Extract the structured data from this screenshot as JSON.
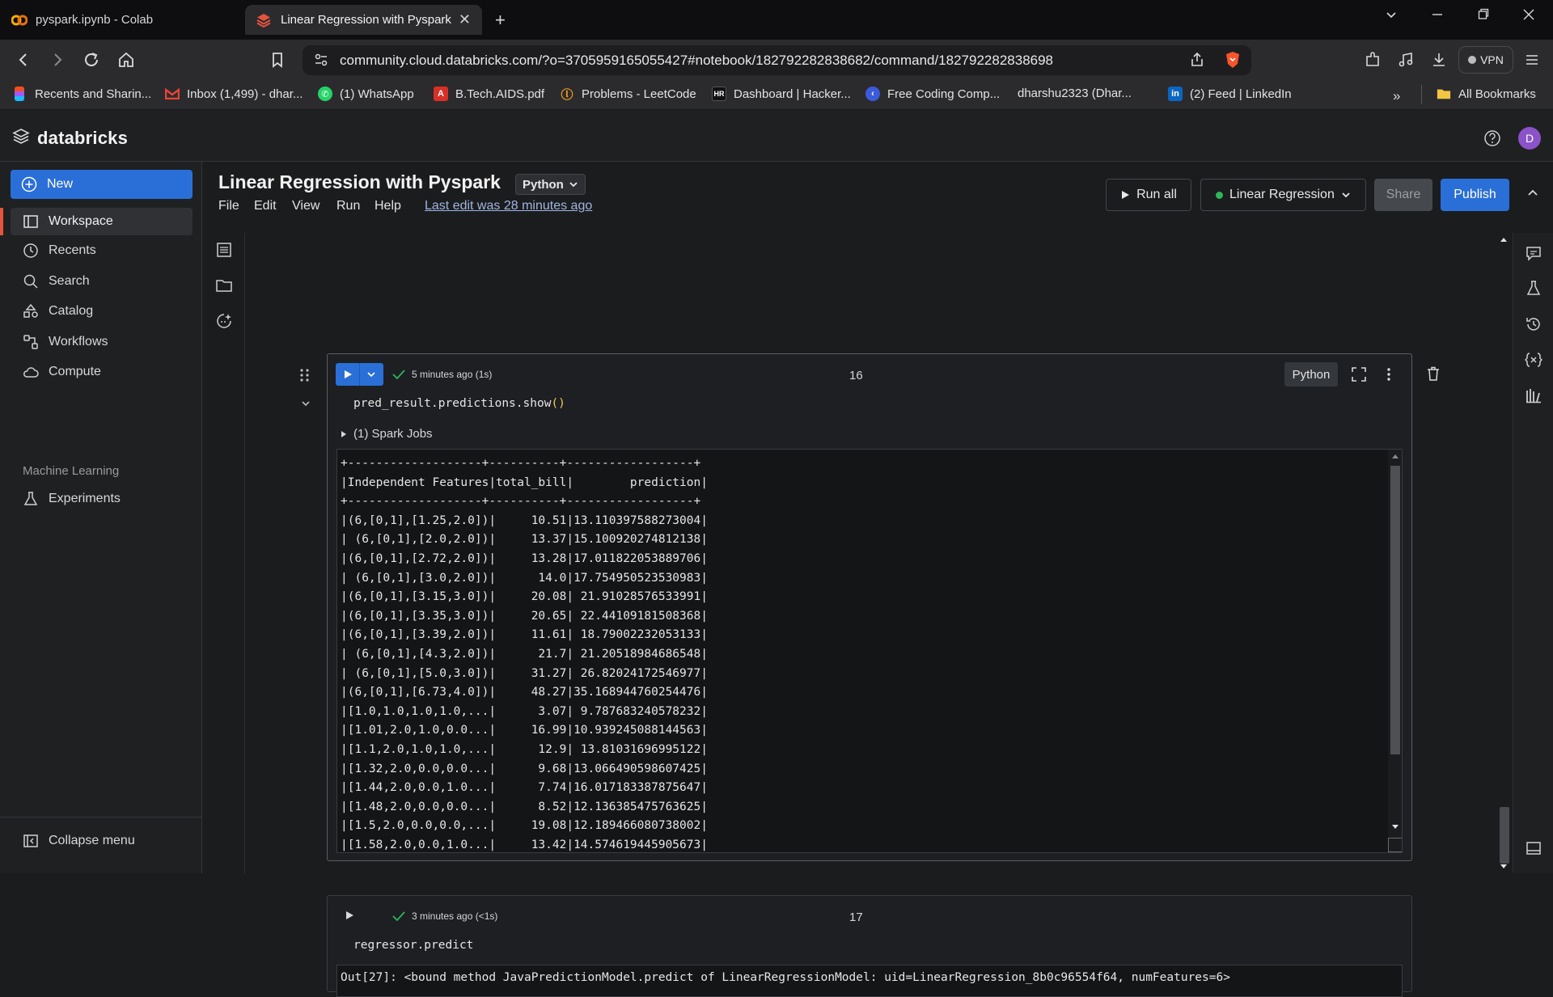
{
  "browser": {
    "tabs": [
      {
        "label": "pyspark.ipynb - Colab",
        "active": false
      },
      {
        "label": "Linear Regression with Pyspark",
        "active": true
      }
    ],
    "url": "community.cloud.databricks.com/?o=3705959165055427#notebook/182792282838682/command/182792282838698",
    "vpn_label": "VPN",
    "bookmarks": [
      "Recents and Sharin...",
      "Inbox (1,499) - dhar...",
      "(1) WhatsApp",
      "B.Tech.AIDS.pdf",
      "Problems - LeetCode",
      "Dashboard | Hacker...",
      "Free Coding Comp...",
      "dharshu2323 (Dhar...",
      "(2) Feed | LinkedIn"
    ],
    "all_bookmarks": "All Bookmarks"
  },
  "app": {
    "brand": "databricks",
    "avatar_initial": "D",
    "accent": "#2a6fd8"
  },
  "sidebar": {
    "new_label": "New",
    "items": [
      "Workspace",
      "Recents",
      "Search",
      "Catalog",
      "Workflows",
      "Compute"
    ],
    "ml_header": "Machine Learning",
    "ml_items": [
      "Experiments"
    ],
    "collapse_label": "Collapse menu"
  },
  "notebook": {
    "title": "Linear Regression with Pyspark",
    "language": "Python",
    "menus": [
      "File",
      "Edit",
      "View",
      "Run",
      "Help"
    ],
    "last_edit": "Last edit was 28 minutes ago",
    "run_all": "Run all",
    "cluster": "Linear Regression",
    "share": "Share",
    "publish": "Publish"
  },
  "cell16": {
    "status": "5 minutes ago (1s)",
    "number": "16",
    "lang": "Python",
    "code_prefix": "pred_result.predictions.show",
    "code_parens": "()",
    "jobs": "(1) Spark Jobs",
    "output": "+-------------------+----------+------------------+\n|Independent Features|total_bill|        prediction|\n+-------------------+----------+------------------+\n|(6,[0,1],[1.25,2.0])|     10.51|13.110397588273004|\n| (6,[0,1],[2.0,2.0])|     13.37|15.100920274812138|\n|(6,[0,1],[2.72,2.0])|     13.28|17.011822053889706|\n| (6,[0,1],[3.0,2.0])|      14.0|17.754950523530983|\n|(6,[0,1],[3.15,3.0])|     20.08| 21.91028576533991|\n|(6,[0,1],[3.35,3.0])|     20.65| 22.44109181508368|\n|(6,[0,1],[3.39,2.0])|     11.61| 18.79002232053133|\n| (6,[0,1],[4.3,2.0])|      21.7| 21.20518984686548|\n| (6,[0,1],[5.0,3.0])|     31.27| 26.82024172546977|\n|(6,[0,1],[6.73,4.0])|     48.27|35.168944760254476|\n|[1.0,1.0,1.0,1.0,...|      3.07| 9.787683240578232|\n|[1.01,2.0,1.0,0.0...|     16.99|10.939245088144563|\n|[1.1,2.0,1.0,1.0,...|      12.9| 13.81031696995122|\n|[1.32,2.0,0.0,0.0...|      9.68|13.066490598607425|\n|[1.44,2.0,0.0,1.0...|      7.74|16.017183387875647|\n|[1.48,2.0,0.0,0.0...|      8.52|12.136385475763625|\n|[1.5,2.0,0.0,0.0,...|     19.08|12.189466080738002|\n|[1.58,2.0,0.0,1.0...|     13.42|14.574619445905673|"
  },
  "cell17": {
    "status": "3 minutes ago (<1s)",
    "number": "17",
    "code": "regressor.predict",
    "output": "Out[27]: <bound method JavaPredictionModel.predict of LinearRegressionModel: uid=LinearRegression_8b0c96554f64, numFeatures=6>"
  }
}
